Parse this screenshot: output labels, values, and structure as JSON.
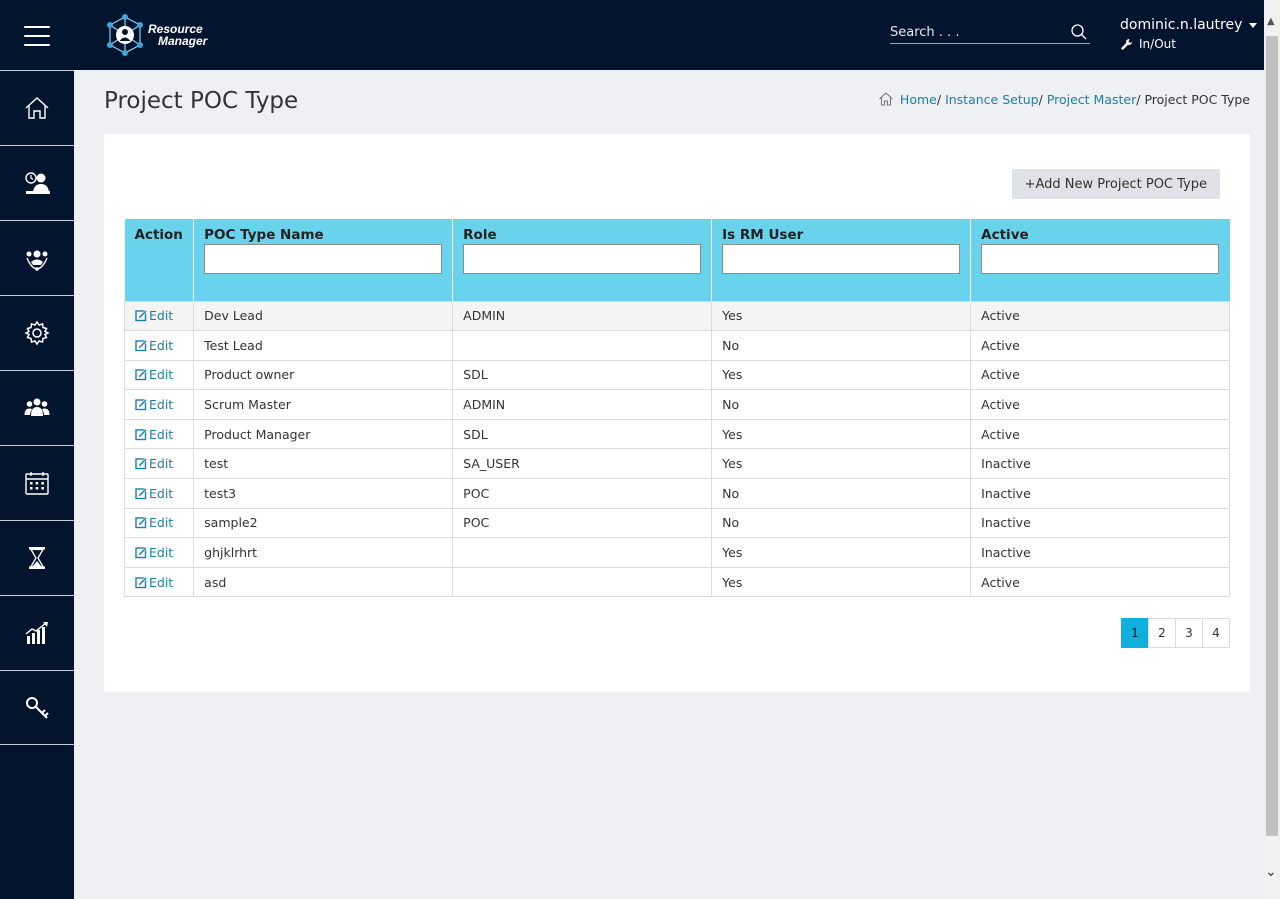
{
  "app": {
    "logo_line1": "Resource",
    "logo_line2": "Manager"
  },
  "header": {
    "search_placeholder": "Search . . .",
    "username": "dominic.n.lautrey",
    "inout_label": "In/Out"
  },
  "sidebar": {
    "items": [
      {
        "icon": "home-icon"
      },
      {
        "icon": "timesheet-user-icon"
      },
      {
        "icon": "team-network-icon"
      },
      {
        "icon": "settings-gear-icon"
      },
      {
        "icon": "users-group-icon"
      },
      {
        "icon": "calendar-icon"
      },
      {
        "icon": "hourglass-icon"
      },
      {
        "icon": "analytics-chart-icon"
      },
      {
        "icon": "key-icon"
      }
    ]
  },
  "page": {
    "title": "Project POC Type",
    "breadcrumb": {
      "home": "Home",
      "instance_setup": "Instance Setup",
      "project_master": "Project Master",
      "current": "Project POC Type",
      "separator": "/"
    },
    "add_button": "+Add New Project POC Type"
  },
  "table": {
    "headers": {
      "action": "Action",
      "poc_type_name": "POC Type Name",
      "role": "Role",
      "is_rm_user": "Is RM User",
      "active": "Active"
    },
    "edit_label": "Edit",
    "rows": [
      {
        "name": "Dev Lead",
        "role": "ADMIN",
        "rm": "Yes",
        "active": "Active"
      },
      {
        "name": "Test Lead",
        "role": "",
        "rm": "No",
        "active": "Active"
      },
      {
        "name": "Product owner",
        "role": "SDL",
        "rm": "Yes",
        "active": "Active"
      },
      {
        "name": "Scrum Master",
        "role": "ADMIN",
        "rm": "No",
        "active": "Active"
      },
      {
        "name": "Product Manager",
        "role": "SDL",
        "rm": "Yes",
        "active": "Active"
      },
      {
        "name": "test",
        "role": "SA_USER",
        "rm": "Yes",
        "active": "Inactive"
      },
      {
        "name": "test3",
        "role": "POC",
        "rm": "No",
        "active": "Inactive"
      },
      {
        "name": "sample2",
        "role": "POC",
        "rm": "No",
        "active": "Inactive"
      },
      {
        "name": "ghjklrhrt",
        "role": "",
        "rm": "Yes",
        "active": "Inactive"
      },
      {
        "name": "asd",
        "role": "",
        "rm": "Yes",
        "active": "Active"
      }
    ]
  },
  "pagination": {
    "pages": [
      "1",
      "2",
      "3",
      "4"
    ],
    "current": "1"
  },
  "colors": {
    "header_bg": "#03142e",
    "table_header": "#69d2ec",
    "link": "#1d7fa6",
    "active_page": "#0fb0dc"
  }
}
